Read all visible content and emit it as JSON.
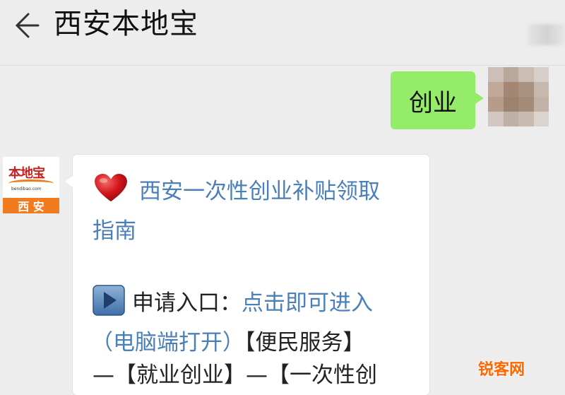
{
  "header": {
    "title": "西安本地宝",
    "back_icon": "back-arrow-icon"
  },
  "user_message": {
    "text": "创业"
  },
  "bot": {
    "avatar": {
      "logo_text": "本地宝",
      "logo_domain": "bendibao.com",
      "city": "西 安"
    },
    "message": {
      "heart_icon": "heart-icon",
      "title_link_line1": "西安一次性创业补贴领取",
      "title_link_line2": "指南",
      "play_icon": "play-icon",
      "apply_label": "申请入口：",
      "apply_link": "点击即可进入",
      "open_hint": "（电脑端打开）",
      "path_part1": "【便民服务】",
      "path_part2": "—【就业创业】—【一次性创"
    }
  },
  "watermark": {
    "text": "锐客网"
  },
  "colors": {
    "background": "#ededed",
    "user_bubble": "#95ec69",
    "link": "#4b7fb8",
    "watermark": "#ff6600",
    "logo_orange": "#f27b1f"
  }
}
